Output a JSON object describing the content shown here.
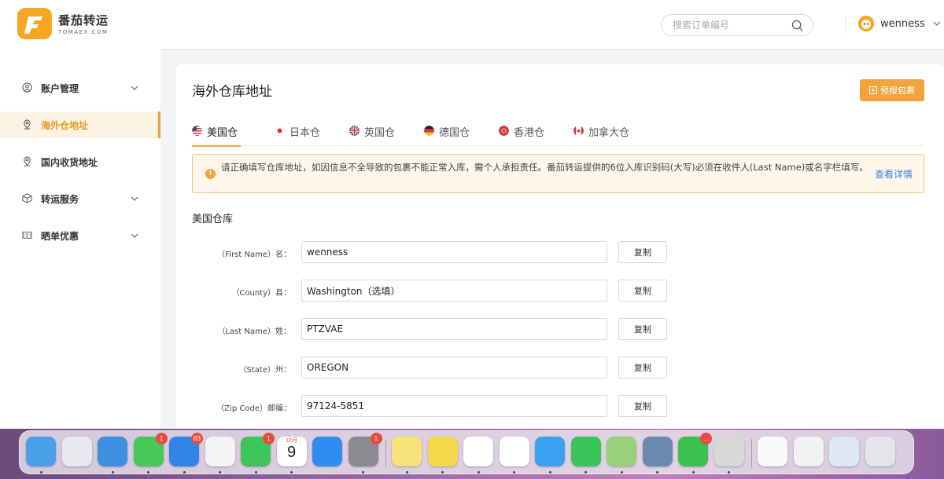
{
  "header": {
    "logo_cn": "番茄转运",
    "logo_en": "TOMAEX.COM",
    "search_placeholder": "搜索订单编号",
    "username": "wenness"
  },
  "sidebar": {
    "items": [
      {
        "label": "账户管理",
        "icon": "user-circle-icon",
        "has_caret": true,
        "active": false
      },
      {
        "label": "海外仓地址",
        "icon": "location-pin-icon",
        "has_caret": false,
        "active": true
      },
      {
        "label": "国内收货地址",
        "icon": "location-pin-icon",
        "has_caret": false,
        "active": false
      },
      {
        "label": "转运服务",
        "icon": "box-icon",
        "has_caret": true,
        "active": false
      },
      {
        "label": "晒单优惠",
        "icon": "ticket-icon",
        "has_caret": true,
        "active": false
      }
    ]
  },
  "main": {
    "title": "海外仓库地址",
    "forecast_button": "预报包裹",
    "tabs": [
      {
        "label": "美国仓",
        "flag": "us-flag-icon",
        "active": true
      },
      {
        "label": "日本仓",
        "flag": "jp-flag-icon",
        "active": false
      },
      {
        "label": "英国仓",
        "flag": "uk-flag-icon",
        "active": false
      },
      {
        "label": "德国仓",
        "flag": "de-flag-icon",
        "active": false
      },
      {
        "label": "香港仓",
        "flag": "hk-flag-icon",
        "active": false
      },
      {
        "label": "加拿大仓",
        "flag": "ca-flag-icon",
        "active": false
      }
    ],
    "notice": {
      "text": "请正确填写仓库地址，如因信息不全导致的包裹不能正常入库，需个人承担责任。番茄转运提供的6位入库识别码(大写)必须在收件人(Last Name)或名字栏填写。",
      "link": "查看详情"
    },
    "section_title": "美国仓库",
    "fields": [
      {
        "label": "（First Name）名：",
        "value": "wenness",
        "copy": "复制"
      },
      {
        "label": "（County）县：",
        "value": "Washington（选填）",
        "copy": "复制"
      },
      {
        "label": "（Last Name）姓：",
        "value": "PTZVAE",
        "copy": "复制"
      },
      {
        "label": "（State）州：",
        "value": "OREGON",
        "copy": "复制"
      },
      {
        "label": "（Zip Code）邮编：",
        "value": "97124-5851",
        "copy": "复制"
      }
    ]
  },
  "colors": {
    "accent": "#f0a43a",
    "link": "#3a86e0",
    "notice_bg": "#fdf6ea"
  },
  "dock": {
    "apps": [
      {
        "name": "finder-icon",
        "color": "#4aa0e8",
        "running": true
      },
      {
        "name": "launchpad-icon",
        "color": "#e8e8ee",
        "running": false
      },
      {
        "name": "safari-icon",
        "color": "#3d8fe0",
        "running": true
      },
      {
        "name": "messages-icon",
        "color": "#48c85a",
        "running": true,
        "badge": "1"
      },
      {
        "name": "mail-icon",
        "color": "#2f86e8",
        "running": true,
        "badge": "83"
      },
      {
        "name": "photos-icon",
        "color": "#f4f4f4",
        "running": true
      },
      {
        "name": "facetime-icon",
        "color": "#3bc55a",
        "running": true,
        "badge": "1"
      },
      {
        "name": "calendar-icon",
        "color": "#ffffff",
        "running": true,
        "month": "12月",
        "day": "9"
      },
      {
        "name": "app-store-icon",
        "color": "#2e8ef0",
        "running": false
      },
      {
        "name": "system-settings-icon",
        "color": "#8a8a90",
        "running": true,
        "badge": "1"
      },
      {
        "name": "notes-icon",
        "color": "#f8e27a",
        "running": true
      },
      {
        "name": "qq-music-icon",
        "color": "#f6d94a",
        "running": true
      },
      {
        "name": "wps-icon",
        "color": "#ffffff",
        "running": true
      },
      {
        "name": "chrome-icon",
        "color": "#ffffff",
        "running": true
      },
      {
        "name": "video-player-icon",
        "color": "#3aa0f0",
        "running": true
      },
      {
        "name": "whatsapp-icon",
        "color": "#39c55a",
        "running": true
      },
      {
        "name": "maps-icon",
        "color": "#9ad07a",
        "running": true
      },
      {
        "name": "preview-icon",
        "color": "#6a8ab0",
        "running": true
      },
      {
        "name": "wechat-icon",
        "color": "#3ac150",
        "running": true,
        "badge": "…"
      },
      {
        "name": "printer-icon",
        "color": "#d8d8d8",
        "running": true
      },
      {
        "name": "document-icon",
        "color": "#fafafa",
        "running": false
      },
      {
        "name": "document-thumbnail-icon",
        "color": "#f2f2f2",
        "running": false
      },
      {
        "name": "screenshot-thumbnail-icon",
        "color": "#e0e8f4",
        "running": false
      },
      {
        "name": "trash-icon",
        "color": "#e4e4ea",
        "running": false
      }
    ]
  }
}
